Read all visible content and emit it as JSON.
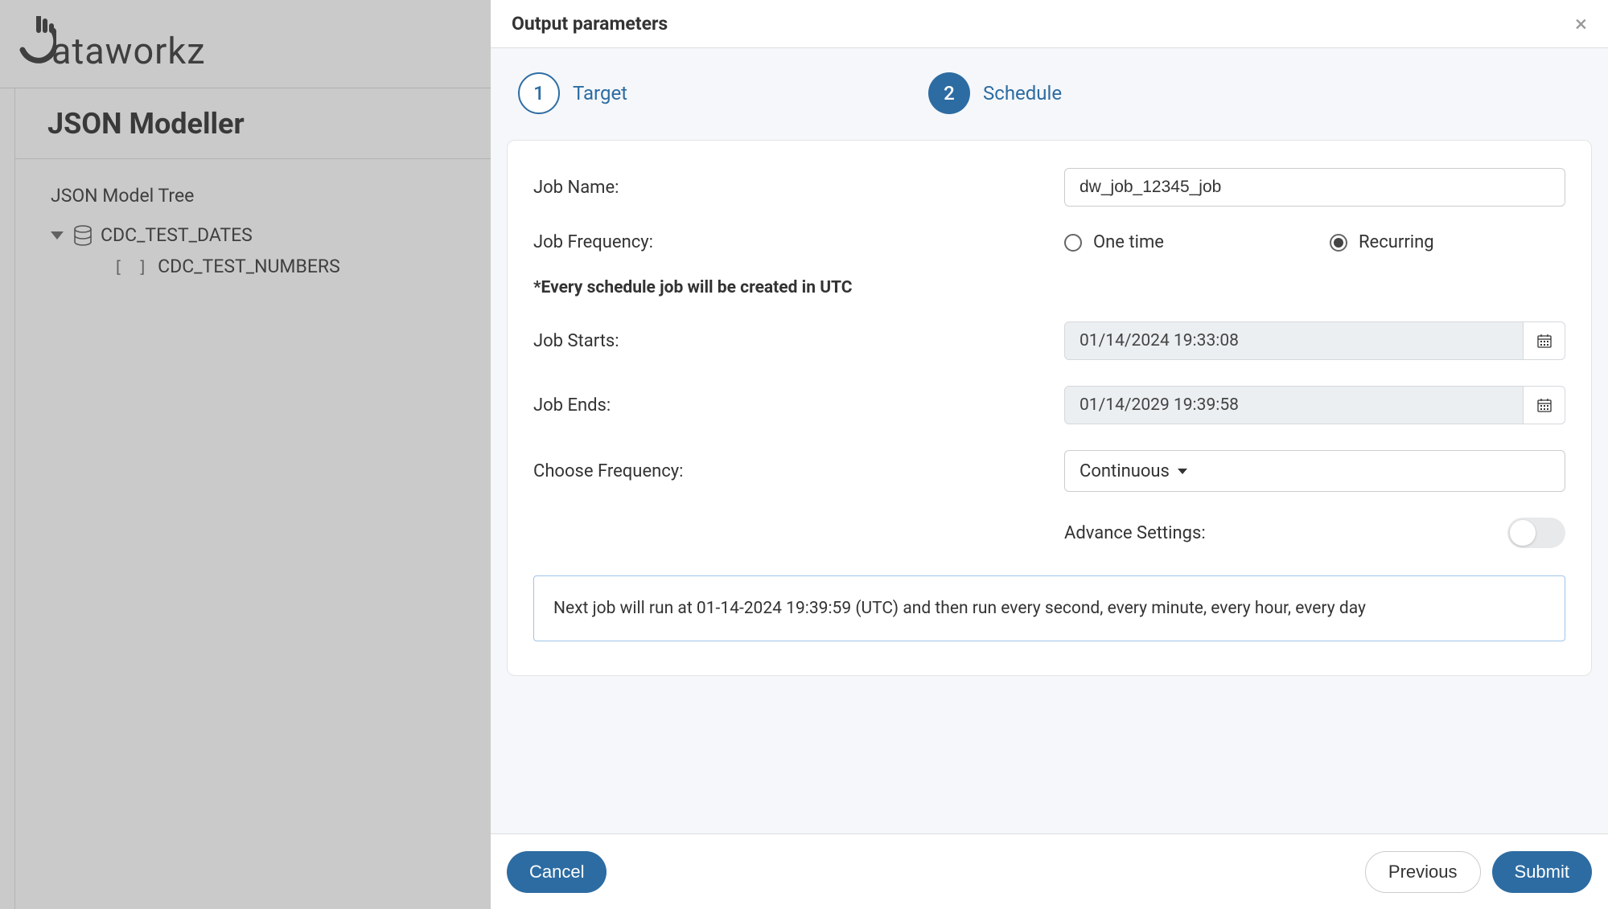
{
  "brand": {
    "logo_text": "ataworkz"
  },
  "page_title": "JSON Modeller",
  "sidebar": {
    "heading": "JSON Model Tree",
    "root_item": "CDC_TEST_DATES",
    "child_item": "CDC_TEST_NUMBERS"
  },
  "modal": {
    "title": "Output parameters",
    "steps": {
      "target_num": "1",
      "target_label": "Target",
      "schedule_num": "2",
      "schedule_label": "Schedule"
    },
    "form": {
      "job_name_label": "Job Name:",
      "job_name_value": "dw_job_12345_job",
      "job_frequency_label": "Job Frequency:",
      "freq_one_time": "One time",
      "freq_recurring": "Recurring",
      "utc_note": "*Every schedule job will be created in UTC",
      "job_starts_label": "Job Starts:",
      "job_starts_value": "01/14/2024 19:33:08",
      "job_ends_label": "Job Ends:",
      "job_ends_value": "01/14/2029 19:39:58",
      "choose_freq_label": "Choose Frequency:",
      "choose_freq_value": "Continuous",
      "advance_label": "Advance Settings:",
      "next_run_text": "Next job will run at 01-14-2024 19:39:59 (UTC) and then run every second, every minute, every hour, every day"
    },
    "footer": {
      "cancel": "Cancel",
      "previous": "Previous",
      "submit": "Submit"
    }
  }
}
